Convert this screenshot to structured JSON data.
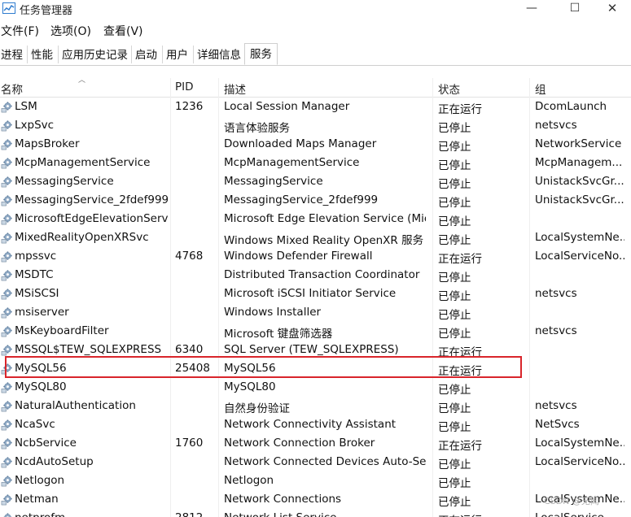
{
  "window": {
    "title": "任务管理器",
    "min_symbol": "—",
    "max_symbol": "☐",
    "close_symbol": "✕"
  },
  "menu": [
    "文件(F)",
    "选项(O)",
    "查看(V)"
  ],
  "tabs": [
    "进程",
    "性能",
    "应用历史记录",
    "启动",
    "用户",
    "详细信息",
    "服务"
  ],
  "active_tab": "服务",
  "columns": {
    "name": "名称",
    "pid": "PID",
    "description": "描述",
    "status": "状态",
    "group": "组"
  },
  "rows": [
    {
      "name": "LSM",
      "pid": "1236",
      "description": "Local Session Manager",
      "status": "正在运行",
      "group": "DcomLaunch"
    },
    {
      "name": "LxpSvc",
      "pid": "",
      "description": "语言体验服务",
      "status": "已停止",
      "group": "netsvcs"
    },
    {
      "name": "MapsBroker",
      "pid": "",
      "description": "Downloaded Maps Manager",
      "status": "已停止",
      "group": "NetworkService"
    },
    {
      "name": "McpManagementService",
      "pid": "",
      "description": "McpManagementService",
      "status": "已停止",
      "group": "McpManagem..."
    },
    {
      "name": "MessagingService",
      "pid": "",
      "description": "MessagingService",
      "status": "已停止",
      "group": "UnistackSvcGr..."
    },
    {
      "name": "MessagingService_2fdef999",
      "pid": "",
      "description": "MessagingService_2fdef999",
      "status": "已停止",
      "group": "UnistackSvcGr..."
    },
    {
      "name": "MicrosoftEdgeElevationServi...",
      "pid": "",
      "description": "Microsoft Edge Elevation Service (Micr...",
      "status": "已停止",
      "group": ""
    },
    {
      "name": "MixedRealityOpenXRSvc",
      "pid": "",
      "description": "Windows Mixed Reality OpenXR 服务",
      "status": "已停止",
      "group": "LocalSystemNe..."
    },
    {
      "name": "mpssvc",
      "pid": "4768",
      "description": "Windows Defender Firewall",
      "status": "正在运行",
      "group": "LocalServiceNo..."
    },
    {
      "name": "MSDTC",
      "pid": "",
      "description": "Distributed Transaction Coordinator",
      "status": "已停止",
      "group": ""
    },
    {
      "name": "MSiSCSI",
      "pid": "",
      "description": "Microsoft iSCSI Initiator Service",
      "status": "已停止",
      "group": "netsvcs"
    },
    {
      "name": "msiserver",
      "pid": "",
      "description": "Windows Installer",
      "status": "已停止",
      "group": ""
    },
    {
      "name": "MsKeyboardFilter",
      "pid": "",
      "description": "Microsoft 键盘筛选器",
      "status": "已停止",
      "group": "netsvcs"
    },
    {
      "name": "MSSQL$TEW_SQLEXPRESS",
      "pid": "6340",
      "description": "SQL Server (TEW_SQLEXPRESS)",
      "status": "正在运行",
      "group": ""
    },
    {
      "name": "MySQL56",
      "pid": "25408",
      "description": "MySQL56",
      "status": "正在运行",
      "group": ""
    },
    {
      "name": "MySQL80",
      "pid": "",
      "description": "MySQL80",
      "status": "已停止",
      "group": ""
    },
    {
      "name": "NaturalAuthentication",
      "pid": "",
      "description": "自然身份验证",
      "status": "已停止",
      "group": "netsvcs"
    },
    {
      "name": "NcaSvc",
      "pid": "",
      "description": "Network Connectivity Assistant",
      "status": "已停止",
      "group": "NetSvcs"
    },
    {
      "name": "NcbService",
      "pid": "1760",
      "description": "Network Connection Broker",
      "status": "正在运行",
      "group": "LocalSystemNe..."
    },
    {
      "name": "NcdAutoSetup",
      "pid": "",
      "description": "Network Connected Devices Auto-Set...",
      "status": "已停止",
      "group": "LocalServiceNo..."
    },
    {
      "name": "Netlogon",
      "pid": "",
      "description": "Netlogon",
      "status": "已停止",
      "group": ""
    },
    {
      "name": "Netman",
      "pid": "",
      "description": "Network Connections",
      "status": "已停止",
      "group": "LocalSystemNe..."
    },
    {
      "name": "netprofm",
      "pid": "2812",
      "description": "Network List Service",
      "status": "正在运行",
      "group": "LocalService"
    }
  ],
  "highlighted_row": "MySQL56",
  "watermark": "CSDN @无闻",
  "colors": {
    "highlight_border": "#d9252b",
    "gear": "#6b8fb3"
  }
}
